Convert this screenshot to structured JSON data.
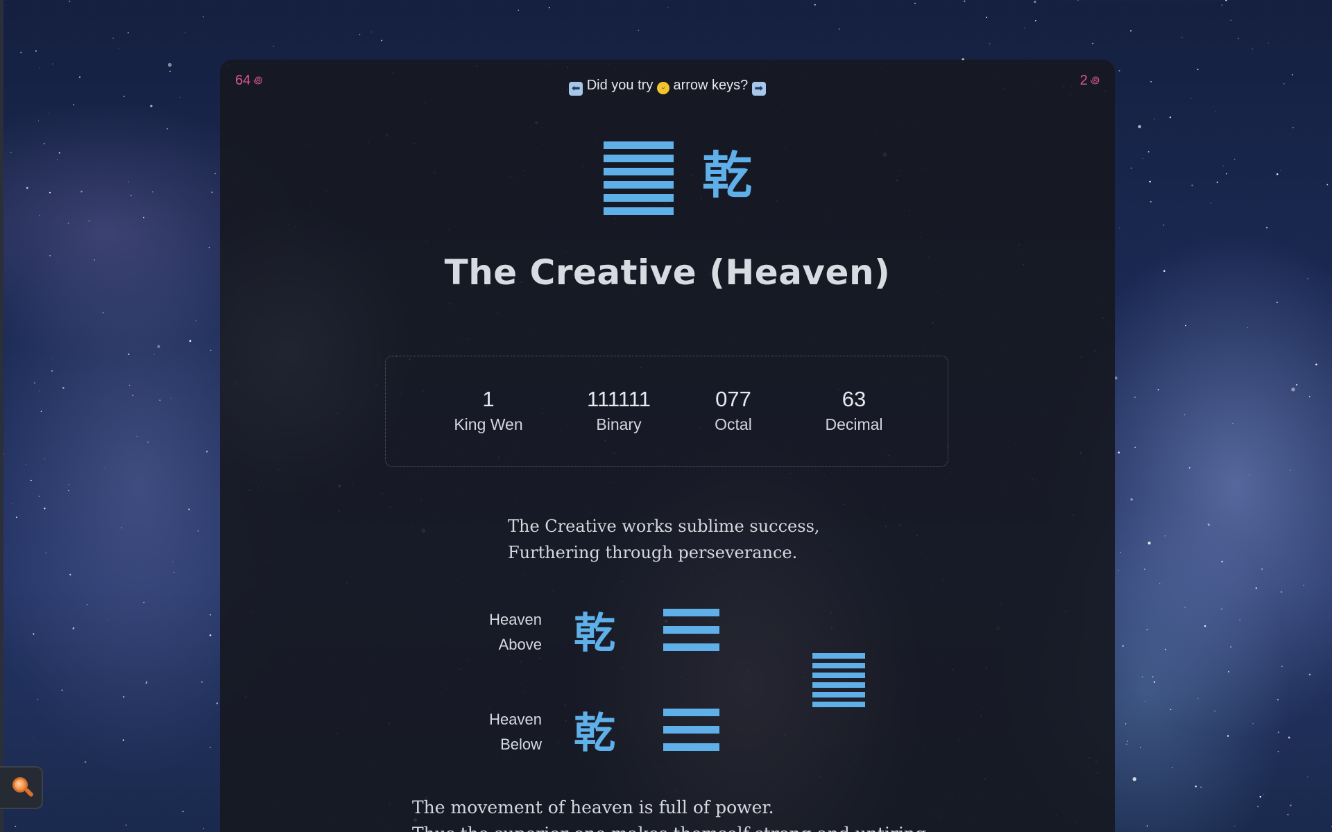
{
  "nav": {
    "prev_number": "64",
    "next_number": "2"
  },
  "hint": {
    "text_before": "Did you try",
    "text_after": "arrow keys?"
  },
  "hexagram": {
    "glyph": "乾",
    "title": "The Creative (Heaven)",
    "line_count": 6
  },
  "stats": [
    {
      "value": "1",
      "label": "King Wen"
    },
    {
      "value": "111111",
      "label": "Binary"
    },
    {
      "value": "077",
      "label": "Octal"
    },
    {
      "value": "63",
      "label": "Decimal"
    }
  ],
  "judgment": [
    "The Creative works sublime success,",
    "Furthering through perseverance."
  ],
  "trigrams": {
    "above": {
      "name": "Heaven",
      "position": "Above",
      "glyph": "乾"
    },
    "below": {
      "name": "Heaven",
      "position": "Below",
      "glyph": "乾"
    }
  },
  "image": [
    "The movement of heaven is full of power.",
    "Thus the superior one makes themself strong and untiring."
  ],
  "colors": {
    "accent": "#5fb0e8",
    "nav": "#d9588f",
    "card": "#16181f",
    "text": "#d7dae3"
  },
  "icons": {
    "left_arrow": "left-arrow-key-icon",
    "emoji": "grinning-face-icon",
    "right_arrow": "right-arrow-key-icon",
    "search": "magnifying-glass-icon",
    "nav": "swirl-icon"
  }
}
